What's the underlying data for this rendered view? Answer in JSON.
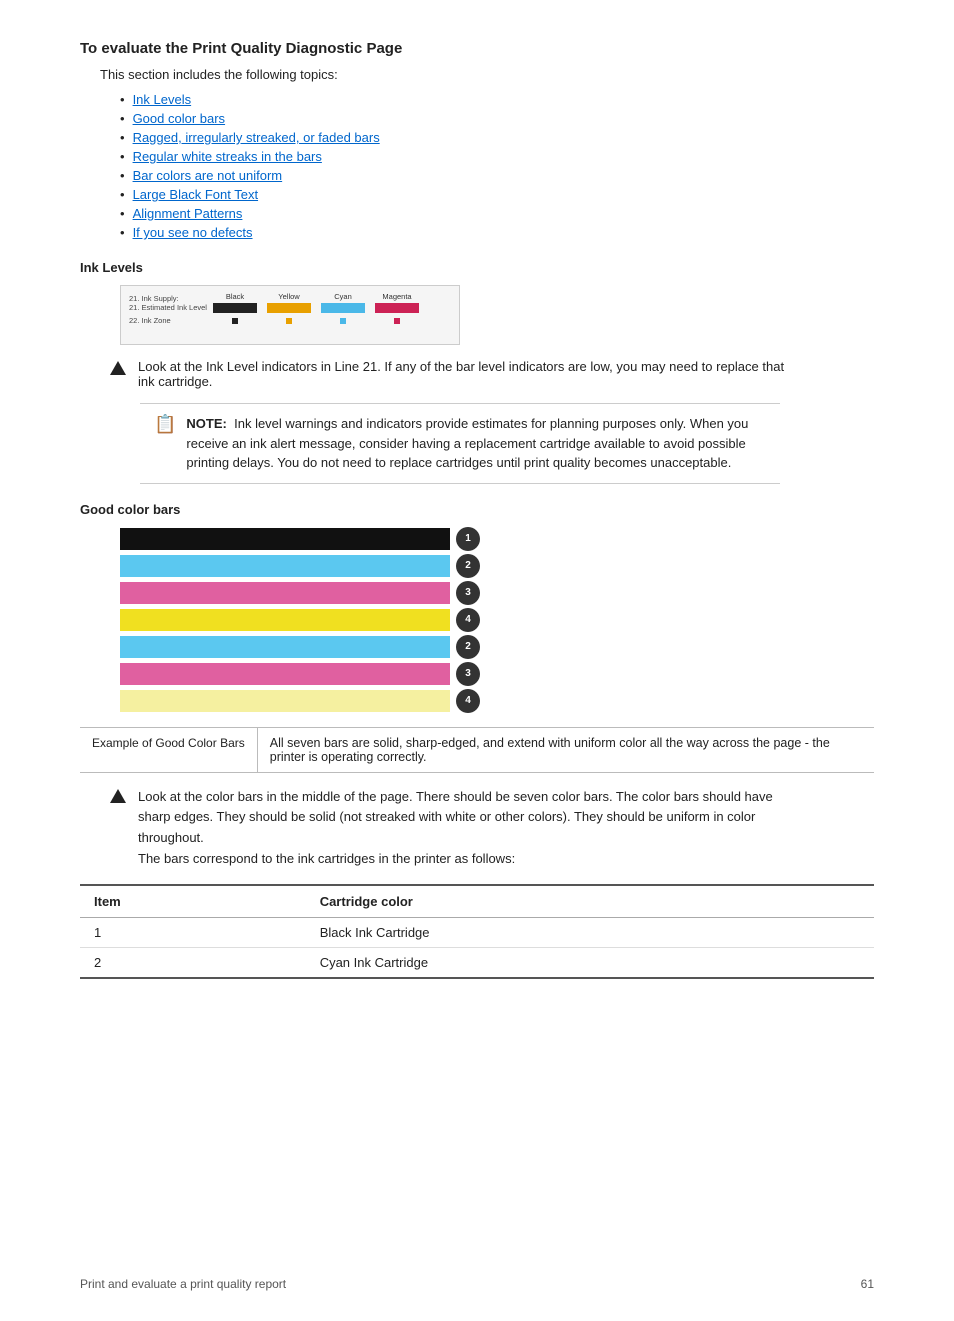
{
  "page": {
    "heading": "To evaluate the Print Quality Diagnostic Page",
    "intro": "This section includes the following topics:",
    "toc": [
      {
        "label": "Ink Levels",
        "href": "#ink-levels"
      },
      {
        "label": "Good color bars",
        "href": "#good-color-bars"
      },
      {
        "label": "Ragged, irregularly streaked, or faded bars",
        "href": "#ragged"
      },
      {
        "label": "Regular white streaks in the bars",
        "href": "#white-streaks"
      },
      {
        "label": "Bar colors are not uniform",
        "href": "#not-uniform"
      },
      {
        "label": "Large Black Font Text",
        "href": "#large-black-font"
      },
      {
        "label": "Alignment Patterns",
        "href": "#alignment"
      },
      {
        "label": "If you see no defects",
        "href": "#no-defects"
      }
    ],
    "ink_levels_heading": "Ink Levels",
    "ink_levels_warning": "Look at the Ink Level indicators in Line 21. If any of the bar level indicators are low, you may need to replace that ink cartridge.",
    "note_label": "NOTE:",
    "note_text": "Ink level warnings and indicators provide estimates for planning purposes only. When you receive an ink alert message, consider having a replacement cartridge available to avoid possible printing delays. You do not need to replace cartridges until print quality becomes unacceptable.",
    "good_color_bars_heading": "Good color bars",
    "color_bars_example_label": "Example of Good Color Bars",
    "color_bars_example_desc": "All seven bars are solid, sharp-edged, and extend with uniform color all the way across the page - the printer is operating correctly.",
    "look_text": "Look at the color bars in the middle of the page. There should be seven color bars. The color bars should have sharp edges. They should be solid (not streaked with white or other colors). They should be uniform in color throughout.\nThe bars correspond to the ink cartridges in the printer as follows:",
    "table_headers": [
      "Item",
      "Cartridge color"
    ],
    "table_rows": [
      {
        "item": "1",
        "color": "Black Ink Cartridge"
      },
      {
        "item": "2",
        "color": "Cyan Ink Cartridge"
      }
    ],
    "footer_left": "Print and evaluate a print quality report",
    "footer_page": "61",
    "bar_numbers": [
      "1",
      "2",
      "3",
      "4",
      "2",
      "3",
      "4"
    ]
  }
}
